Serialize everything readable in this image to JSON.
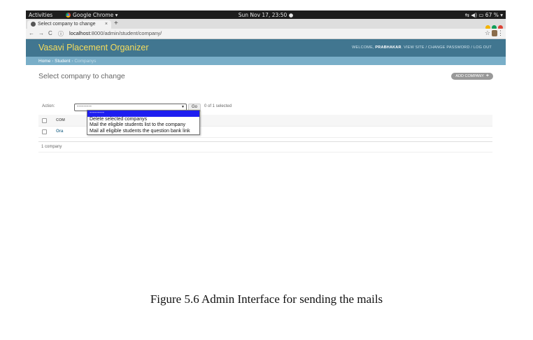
{
  "topbar": {
    "activities": "Activities",
    "app_menu": "Google Chrome ▾",
    "clock": "Sun Nov 17, 23:50 ●",
    "tray": "⇆  ◀)  ▭ 67 % ▾"
  },
  "browser": {
    "tab_title": "Select company to change",
    "tab_close": "×",
    "new_tab": "+",
    "url_host": "localhost",
    "url_path": ":8000/admin/student/company/",
    "window_controls": [
      "#f4b400",
      "#0f9d58",
      "#db4437"
    ]
  },
  "header": {
    "site_name": "Vasavi Placement Organizer",
    "welcome": "WELCOME,",
    "username": "PRABHAKAR",
    "links": "VIEW SITE / CHANGE PASSWORD / LOG OUT"
  },
  "breadcrumbs": {
    "home": "Home",
    "student": "Student",
    "current": "Companys"
  },
  "content": {
    "title": "Select company to change",
    "add_button": "ADD COMPANY",
    "add_icon": "+"
  },
  "actions": {
    "label": "Action:",
    "selected_value": "---------",
    "go": "Go",
    "selection_count": "0 of 1 selected",
    "options": [
      "---------",
      "Delete selected companys",
      "Mail the eligible students list to the company",
      "Mail all eligible students the question bank link"
    ]
  },
  "table": {
    "header": "COM",
    "rows": [
      "Ora"
    ]
  },
  "paginator": "1 company",
  "caption": "Figure 5.6 Admin Interface for sending the mails",
  "colors": {
    "header_bg": "#417690",
    "brand": "#f5dd5d",
    "breadcrumbs_bg": "#79aec8",
    "link": "#447e9b",
    "dropdown_highlight": "#1e1ef0"
  }
}
